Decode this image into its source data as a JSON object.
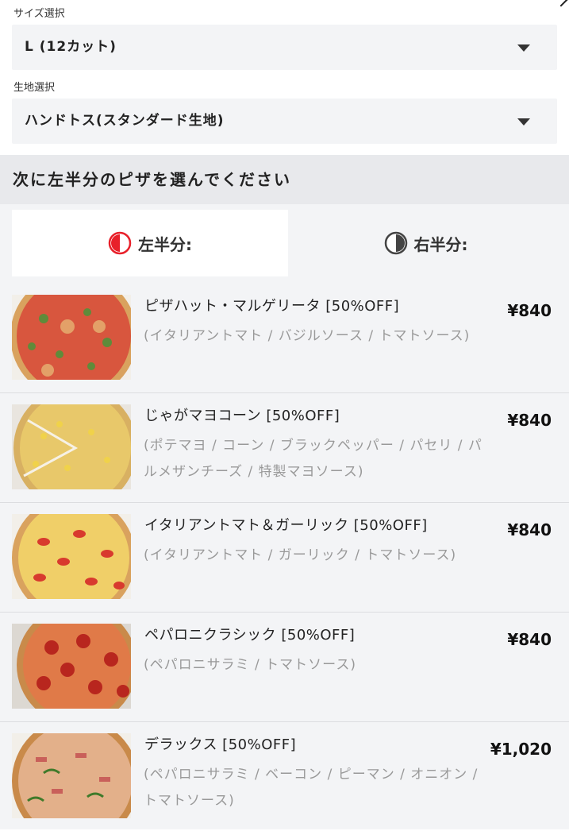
{
  "size_select": {
    "label": "サイズ選択",
    "value": "L (12カット)"
  },
  "crust_select": {
    "label": "生地選択",
    "value": "ハンドトス(スタンダード生地)"
  },
  "section": {
    "title": "次に左半分のピザを選んでください"
  },
  "half_tabs": {
    "left_label": "左半分:",
    "right_label": "右半分:"
  },
  "colors": {
    "accent": "#e8202a",
    "panel": "#f3f4f6",
    "header": "#e8e9ec"
  },
  "menu": [
    {
      "name": "ピザハット・マルゲリータ [50%OFF]",
      "desc": "(イタリアントマト / バジルソース / トマトソース)",
      "price": "¥840"
    },
    {
      "name": "じゃがマヨコーン [50%OFF]",
      "desc": "(ポテマヨ / コーン / ブラックペッパー / パセリ / パルメザンチーズ / 特製マヨソース)",
      "price": "¥840"
    },
    {
      "name": "イタリアントマト＆ガーリック [50%OFF]",
      "desc": "(イタリアントマト / ガーリック / トマトソース)",
      "price": "¥840"
    },
    {
      "name": "ペパロニクラシック [50%OFF]",
      "desc": "(ペパロニサラミ / トマトソース)",
      "price": "¥840"
    },
    {
      "name": "デラックス [50%OFF]",
      "desc": "(ペパロニサラミ / ベーコン / ピーマン / オニオン / トマトソース)",
      "price": "¥1,020"
    }
  ]
}
